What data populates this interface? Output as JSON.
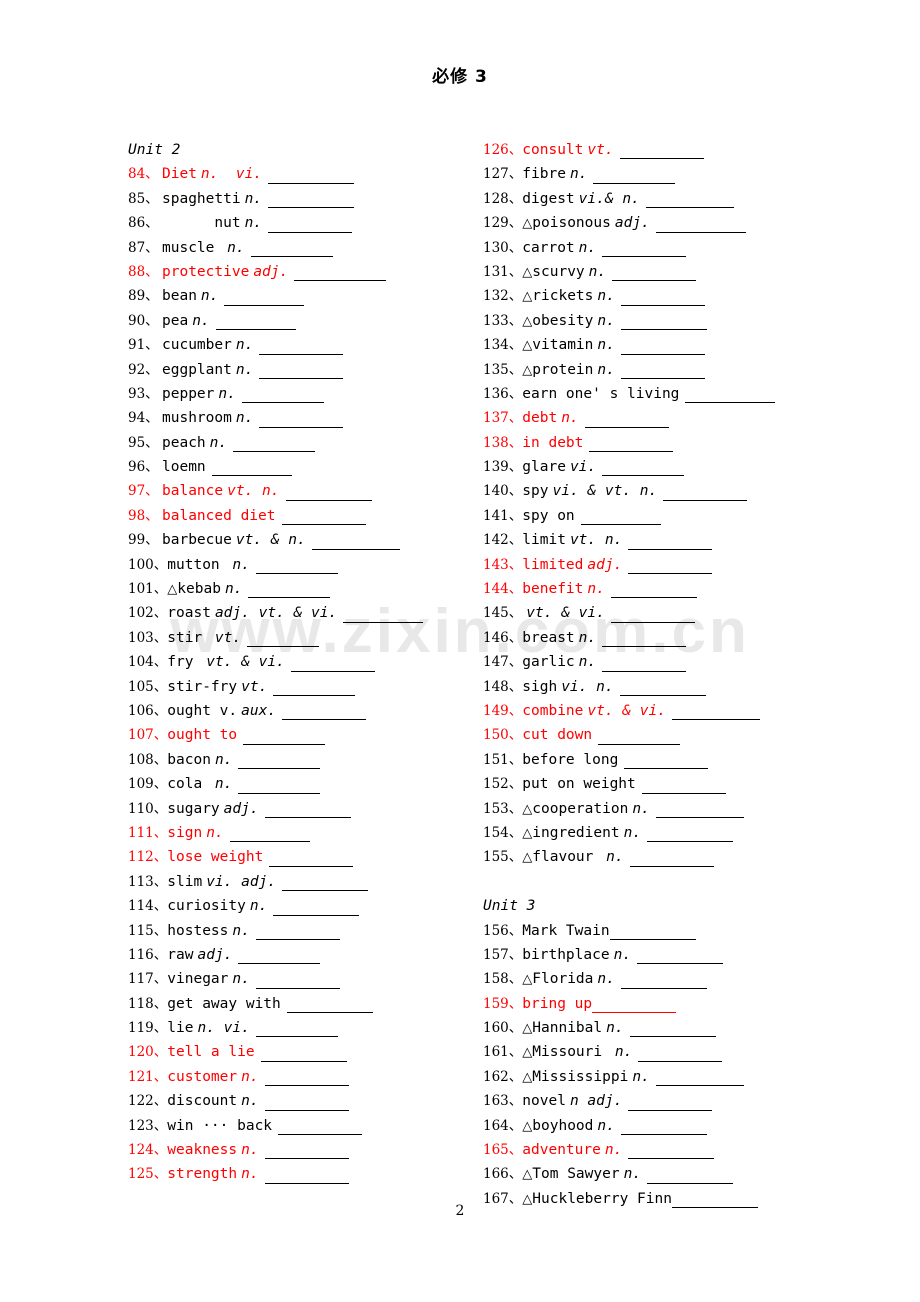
{
  "header": {
    "title": "必修 3"
  },
  "footer": {
    "page_number": "2"
  },
  "watermark": {
    "text": "www.zixin.com.cn"
  },
  "columns": {
    "left": {
      "unit_heading": "Unit 2",
      "items": [
        {
          "num": "84、",
          "tri": "",
          "word": "Diet",
          "pos": "n.  vi.",
          "blank": 86,
          "red": true
        },
        {
          "num": "85、",
          "tri": "",
          "word": "spaghetti",
          "pos": "n.",
          "blank": 86,
          "red": false
        },
        {
          "num": "86、",
          "tri": "",
          "word": "      nut",
          "pos": "n.",
          "blank": 84,
          "red": false
        },
        {
          "num": "87、",
          "tri": "",
          "word": "muscle",
          "pos": " n.",
          "blank": 82,
          "red": false
        },
        {
          "num": "88、",
          "tri": "",
          "word": "protective",
          "pos": "adj.",
          "blank": 92,
          "red": true
        },
        {
          "num": "89、",
          "tri": "",
          "word": "bean",
          "pos": "n.",
          "blank": 80,
          "red": false
        },
        {
          "num": "90、",
          "tri": "",
          "word": "pea",
          "pos": "n.",
          "blank": 80,
          "red": false
        },
        {
          "num": "91、",
          "tri": "",
          "word": "cucumber",
          "pos": "n.",
          "blank": 84,
          "red": false
        },
        {
          "num": "92、",
          "tri": "",
          "word": "eggplant",
          "pos": "n.",
          "blank": 84,
          "red": false
        },
        {
          "num": "93、",
          "tri": "",
          "word": "pepper",
          "pos": "n.",
          "blank": 82,
          "red": false
        },
        {
          "num": "94、",
          "tri": "",
          "word": "mushroom",
          "pos": "n.",
          "blank": 84,
          "red": false
        },
        {
          "num": "95、",
          "tri": "",
          "word": "peach",
          "pos": "n.",
          "blank": 82,
          "red": false
        },
        {
          "num": "96、",
          "tri": "",
          "word": "loemn",
          "pos": "",
          "blank": 80,
          "red": false
        },
        {
          "num": "97、",
          "tri": "",
          "word": "balance",
          "pos": "vt. n.",
          "blank": 86,
          "red": true
        },
        {
          "num": "98、",
          "tri": "",
          "word": "balanced diet",
          "pos": "",
          "blank": 84,
          "red": true
        },
        {
          "num": "99、",
          "tri": "",
          "word": "barbecue",
          "pos": "vt. & n.",
          "blank": 88,
          "red": false
        },
        {
          "num": "100、",
          "tri": "",
          "word": "mutton",
          "pos": " n.",
          "blank": 82,
          "red": false
        },
        {
          "num": "101、",
          "tri": "△",
          "word": "kebab",
          "pos": "n.",
          "blank": 82,
          "red": false
        },
        {
          "num": "102、",
          "tri": "",
          "word": "roast",
          "pos": "adj. vt. & vi.",
          "blank": 80,
          "red": false
        },
        {
          "num": "103、",
          "tri": "",
          "word": "stir",
          "pos": " vt.",
          "blank": 72,
          "red": false
        },
        {
          "num": "104、",
          "tri": "",
          "word": "fry",
          "pos": " vt. & vi.",
          "blank": 84,
          "red": false
        },
        {
          "num": "105、",
          "tri": "",
          "word": "stir-fry",
          "pos": "vt.",
          "blank": 82,
          "red": false
        },
        {
          "num": "106、",
          "tri": "",
          "word": "ought v.",
          "pos": "aux.",
          "blank": 84,
          "red": false
        },
        {
          "num": "107、",
          "tri": "",
          "word": "ought to",
          "pos": "",
          "blank": 82,
          "red": true
        },
        {
          "num": "108、",
          "tri": "",
          "word": "bacon",
          "pos": "n.",
          "blank": 82,
          "red": false
        },
        {
          "num": "109、",
          "tri": "",
          "word": "cola",
          "pos": " n.",
          "blank": 82,
          "red": false
        },
        {
          "num": "110、",
          "tri": "",
          "word": "sugary",
          "pos": "adj.",
          "blank": 86,
          "red": false
        },
        {
          "num": "111、",
          "tri": "",
          "word": "sign",
          "pos": "n.",
          "blank": 80,
          "red": true
        },
        {
          "num": "112、",
          "tri": "",
          "word": "lose weight",
          "pos": "",
          "blank": 84,
          "red": true
        },
        {
          "num": "113、",
          "tri": "",
          "word": "slim",
          "pos": "vi. adj.",
          "blank": 86,
          "red": false
        },
        {
          "num": "114、",
          "tri": "",
          "word": "curiosity",
          "pos": "n.",
          "blank": 86,
          "red": false
        },
        {
          "num": "115、",
          "tri": "",
          "word": "hostess",
          "pos": "n.",
          "blank": 84,
          "red": false
        },
        {
          "num": "116、",
          "tri": "",
          "word": "raw",
          "pos": "adj.",
          "blank": 82,
          "red": false
        },
        {
          "num": "117、",
          "tri": "",
          "word": "vinegar",
          "pos": "n.",
          "blank": 84,
          "red": false
        },
        {
          "num": "118、",
          "tri": "",
          "word": "get away with",
          "pos": "",
          "blank": 86,
          "red": false
        },
        {
          "num": "119、",
          "tri": "",
          "word": "lie",
          "pos": "n. vi.",
          "blank": 82,
          "red": false
        },
        {
          "num": "120、",
          "tri": "",
          "word": "tell a lie",
          "pos": "",
          "blank": 86,
          "red": true
        },
        {
          "num": "121、",
          "tri": "",
          "word": "customer",
          "pos": "n.",
          "blank": 84,
          "red": true
        },
        {
          "num": "122、",
          "tri": "",
          "word": "discount",
          "pos": "n.",
          "blank": 84,
          "red": false
        },
        {
          "num": "123、",
          "tri": "",
          "word": "win ··· back",
          "pos": "",
          "blank": 84,
          "red": false
        },
        {
          "num": "124、",
          "tri": "",
          "word": "weakness",
          "pos": "n.",
          "blank": 84,
          "red": true
        },
        {
          "num": "125、",
          "tri": "",
          "word": "strength",
          "pos": "n.",
          "blank": 84,
          "red": true
        }
      ]
    },
    "right": {
      "items_before_unit3": [
        {
          "num": "126、",
          "tri": "",
          "word": "consult",
          "pos": "vt.",
          "blank": 84,
          "red": true
        },
        {
          "num": "127、",
          "tri": "",
          "word": "fibre",
          "pos": "n.",
          "blank": 82,
          "red": false
        },
        {
          "num": "128、",
          "tri": "",
          "word": "digest",
          "pos": "vi.& n.",
          "blank": 88,
          "red": false
        },
        {
          "num": "129、",
          "tri": "△",
          "word": "poisonous",
          "pos": "adj.",
          "blank": 90,
          "red": false
        },
        {
          "num": "130、",
          "tri": "",
          "word": "carrot",
          "pos": "n.",
          "blank": 84,
          "red": false
        },
        {
          "num": "131、",
          "tri": "△",
          "word": "scurvy",
          "pos": "n.",
          "blank": 84,
          "red": false
        },
        {
          "num": "132、",
          "tri": "△",
          "word": "rickets",
          "pos": "n.",
          "blank": 84,
          "red": false
        },
        {
          "num": "133、",
          "tri": "△",
          "word": "obesity",
          "pos": "n.",
          "blank": 86,
          "red": false
        },
        {
          "num": "134、",
          "tri": "△",
          "word": "vitamin",
          "pos": "n.",
          "blank": 84,
          "red": false
        },
        {
          "num": "135、",
          "tri": "△",
          "word": "protein",
          "pos": "n.",
          "blank": 84,
          "red": false
        },
        {
          "num": "136、",
          "tri": "",
          "word": "earn one' s living",
          "pos": "",
          "blank": 90,
          "red": false
        },
        {
          "num": "137、",
          "tri": "",
          "word": "debt",
          "pos": "n.",
          "blank": 84,
          "red": true
        },
        {
          "num": "138、",
          "tri": "",
          "word": "in debt",
          "pos": "",
          "blank": 84,
          "red": true
        },
        {
          "num": "139、",
          "tri": "",
          "word": "glare",
          "pos": "vi.",
          "blank": 82,
          "red": false
        },
        {
          "num": "140、",
          "tri": "",
          "word": "spy",
          "pos": "vi. & vt. n.",
          "blank": 84,
          "red": false
        },
        {
          "num": "141、",
          "tri": "",
          "word": "spy on",
          "pos": "",
          "blank": 80,
          "red": false
        },
        {
          "num": "142、",
          "tri": "",
          "word": "limit",
          "pos": "vt. n.",
          "blank": 84,
          "red": false
        },
        {
          "num": "143、",
          "tri": "",
          "word": "limited",
          "pos": "adj.",
          "blank": 84,
          "red": true
        },
        {
          "num": "144、",
          "tri": "",
          "word": "benefit",
          "pos": "n.",
          "blank": 86,
          "red": true
        },
        {
          "num": "145、",
          "tri": "",
          "word": "",
          "pos": "vt. & vi.",
          "blank": 84,
          "red": false
        },
        {
          "num": "146、",
          "tri": "",
          "word": "breast",
          "pos": "n.",
          "blank": 84,
          "red": false
        },
        {
          "num": "147、",
          "tri": "",
          "word": "garlic",
          "pos": "n.",
          "blank": 84,
          "red": false
        },
        {
          "num": "148、",
          "tri": "",
          "word": "sigh",
          "pos": "vi. n.",
          "blank": 86,
          "red": false
        },
        {
          "num": "149、",
          "tri": "",
          "word": "combine",
          "pos": "vt. & vi.",
          "blank": 88,
          "red": true
        },
        {
          "num": "150、",
          "tri": "",
          "word": "cut down",
          "pos": "",
          "blank": 82,
          "red": true
        },
        {
          "num": "151、",
          "tri": "",
          "word": "before long",
          "pos": "",
          "blank": 84,
          "red": false
        },
        {
          "num": "152、",
          "tri": "",
          "word": "put on weight",
          "pos": "",
          "blank": 84,
          "red": false
        },
        {
          "num": "153、",
          "tri": "△",
          "word": "cooperation",
          "pos": "n.",
          "blank": 88,
          "red": false
        },
        {
          "num": "154、",
          "tri": "△",
          "word": "ingredient",
          "pos": "n.",
          "blank": 86,
          "red": false
        },
        {
          "num": "155、",
          "tri": "△",
          "word": "flavour",
          "pos": " n.",
          "blank": 84,
          "red": false
        }
      ],
      "unit_heading": "Unit 3",
      "items_after_unit3": [
        {
          "num": "156、",
          "tri": "",
          "word": "Mark Twain",
          "pos": "",
          "blank": 86,
          "red": false,
          "tight": true
        },
        {
          "num": "157、",
          "tri": "",
          "word": "birthplace",
          "pos": "n.",
          "blank": 86,
          "red": false
        },
        {
          "num": "158、",
          "tri": "△",
          "word": "Florida",
          "pos": "n.",
          "blank": 86,
          "red": false
        },
        {
          "num": "159、",
          "tri": "",
          "word": "bring up",
          "pos": "",
          "blank": 84,
          "red": true,
          "tight": true,
          "blank_red_lead": true
        },
        {
          "num": "160、",
          "tri": "△",
          "word": "Hannibal",
          "pos": "n.",
          "blank": 86,
          "red": false
        },
        {
          "num": "161、",
          "tri": "△",
          "word": "Missouri",
          "pos": " n.",
          "blank": 84,
          "red": false
        },
        {
          "num": "162、",
          "tri": "△",
          "word": "Mississippi",
          "pos": "n.",
          "blank": 88,
          "red": false
        },
        {
          "num": "163、",
          "tri": "",
          "word": "novel",
          "pos": "n adj.",
          "blank": 84,
          "red": false
        },
        {
          "num": "164、",
          "tri": "△",
          "word": "boyhood",
          "pos": "n.",
          "blank": 86,
          "red": false
        },
        {
          "num": "165、",
          "tri": "",
          "word": "adventure",
          "pos": "n.",
          "blank": 86,
          "red": true
        },
        {
          "num": "166、",
          "tri": "△",
          "word": "Tom Sawyer",
          "pos": "n.",
          "blank": 86,
          "red": false
        },
        {
          "num": "167、",
          "tri": "△",
          "word": "Huckleberry Finn",
          "pos": "",
          "blank": 86,
          "red": false,
          "tight": true
        }
      ]
    }
  }
}
